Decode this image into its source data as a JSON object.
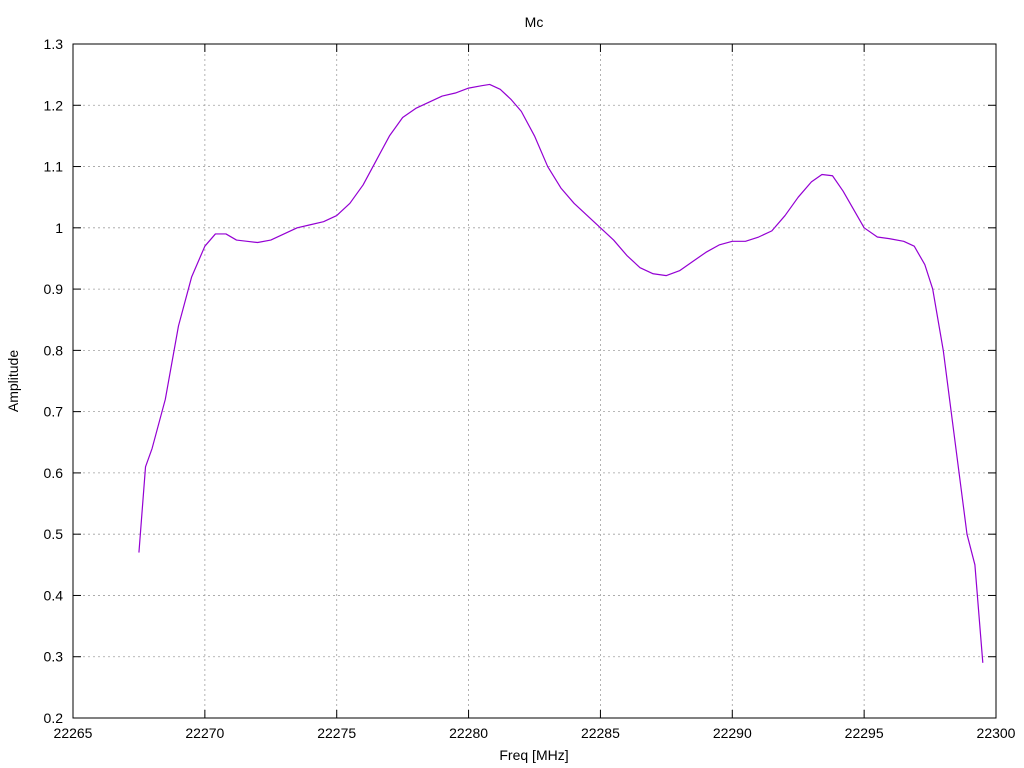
{
  "chart_data": {
    "type": "line",
    "title": "Mc",
    "xlabel": "Freq [MHz]",
    "ylabel": "Amplitude",
    "xlim": [
      22265,
      22300
    ],
    "ylim": [
      0.2,
      1.3
    ],
    "xticks": [
      "22265",
      "22270",
      "22275",
      "22280",
      "22285",
      "22290",
      "22295",
      "22300"
    ],
    "yticks": [
      "0.2",
      "0.3",
      "0.4",
      "0.5",
      "0.6",
      "0.7",
      "0.8",
      "0.9",
      "1",
      "1.1",
      "1.2",
      "1.3"
    ],
    "grid": true,
    "legend": "none",
    "line_color": "#9400d3",
    "series": [
      {
        "x": [
          22267.5,
          22267.75,
          22268.0,
          22268.5,
          22269.0,
          22269.5,
          22270.0,
          22270.4,
          22270.8,
          22271.2,
          22271.6,
          22272.0,
          22272.5,
          22273.0,
          22273.5,
          22274.0,
          22274.5,
          22275.0,
          22275.5,
          22276.0,
          22276.5,
          22277.0,
          22277.5,
          22278.0,
          22278.5,
          22279.0,
          22279.5,
          22280.0,
          22280.5,
          22280.8,
          22281.2,
          22281.6,
          22282.0,
          22282.5,
          22283.0,
          22283.5,
          22284.0,
          22284.5,
          22285.0,
          22285.5,
          22286.0,
          22286.5,
          22287.0,
          22287.5,
          22288.0,
          22288.5,
          22289.0,
          22289.5,
          22290.0,
          22290.5,
          22291.0,
          22291.5,
          22292.0,
          22292.5,
          22293.0,
          22293.4,
          22293.8,
          22294.2,
          22294.6,
          22295.0,
          22295.5,
          22296.0,
          22296.5,
          22296.9,
          22297.3,
          22297.6,
          22298.0,
          22298.3,
          22298.6,
          22298.9,
          22299.2,
          22299.5
        ],
        "y": [
          0.47,
          0.61,
          0.64,
          0.72,
          0.84,
          0.92,
          0.97,
          0.99,
          0.99,
          0.98,
          0.978,
          0.976,
          0.98,
          0.99,
          1.0,
          1.005,
          1.01,
          1.02,
          1.04,
          1.07,
          1.11,
          1.15,
          1.18,
          1.195,
          1.205,
          1.215,
          1.22,
          1.228,
          1.232,
          1.234,
          1.226,
          1.21,
          1.19,
          1.15,
          1.1,
          1.065,
          1.04,
          1.02,
          1.0,
          0.98,
          0.955,
          0.935,
          0.925,
          0.922,
          0.93,
          0.945,
          0.96,
          0.972,
          0.978,
          0.978,
          0.985,
          0.995,
          1.02,
          1.05,
          1.075,
          1.087,
          1.085,
          1.06,
          1.03,
          1.0,
          0.985,
          0.982,
          0.978,
          0.97,
          0.94,
          0.9,
          0.8,
          0.7,
          0.6,
          0.5,
          0.45,
          0.29
        ]
      }
    ]
  }
}
